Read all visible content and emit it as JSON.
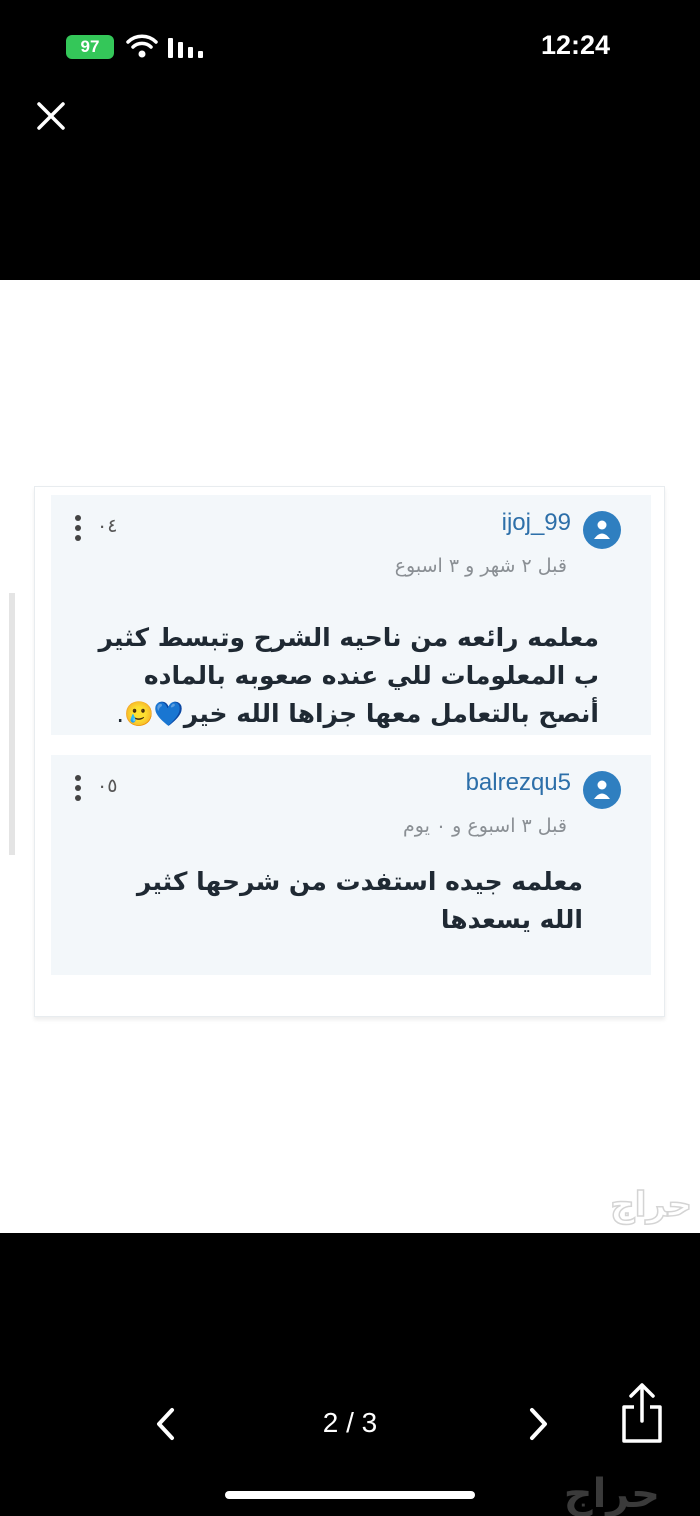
{
  "status_bar": {
    "battery": "97",
    "time": "12:24"
  },
  "comments": [
    {
      "username": "ijoj_99",
      "timestamp": "قبل ٢ شهر و ٣ اسبوع",
      "score": "٠٤",
      "lines": [
        "معلمه رائعه من ناحيه الشرح وتبسط كثير",
        "ب المعلومات للي عنده صعوبه بالماده",
        "أنصح بالتعامل معها جزاها الله خير"
      ],
      "emoji": "💙🥲."
    },
    {
      "username": "balrezqu5",
      "timestamp": "قبل ٣ اسبوع و ٠ يوم",
      "score": "٠٥",
      "lines": [
        "معلمه جيده استفدت من شرحها كثير",
        "الله يسعدها"
      ]
    }
  ],
  "watermark": "حراج",
  "viewer": {
    "page_indicator": "2 / 3"
  },
  "icons": [
    "battery-icon",
    "wifi-icon",
    "signal-icon",
    "close-icon",
    "user-avatar-icon",
    "more-vertical-icon",
    "chevron-left-icon",
    "chevron-right-icon",
    "share-icon"
  ],
  "colors": {
    "background": "#000000",
    "battery": "#34c759",
    "username": "#2d6fa9",
    "avatar": "#2f7fc0",
    "comment_bg": "#f3f7fa"
  }
}
